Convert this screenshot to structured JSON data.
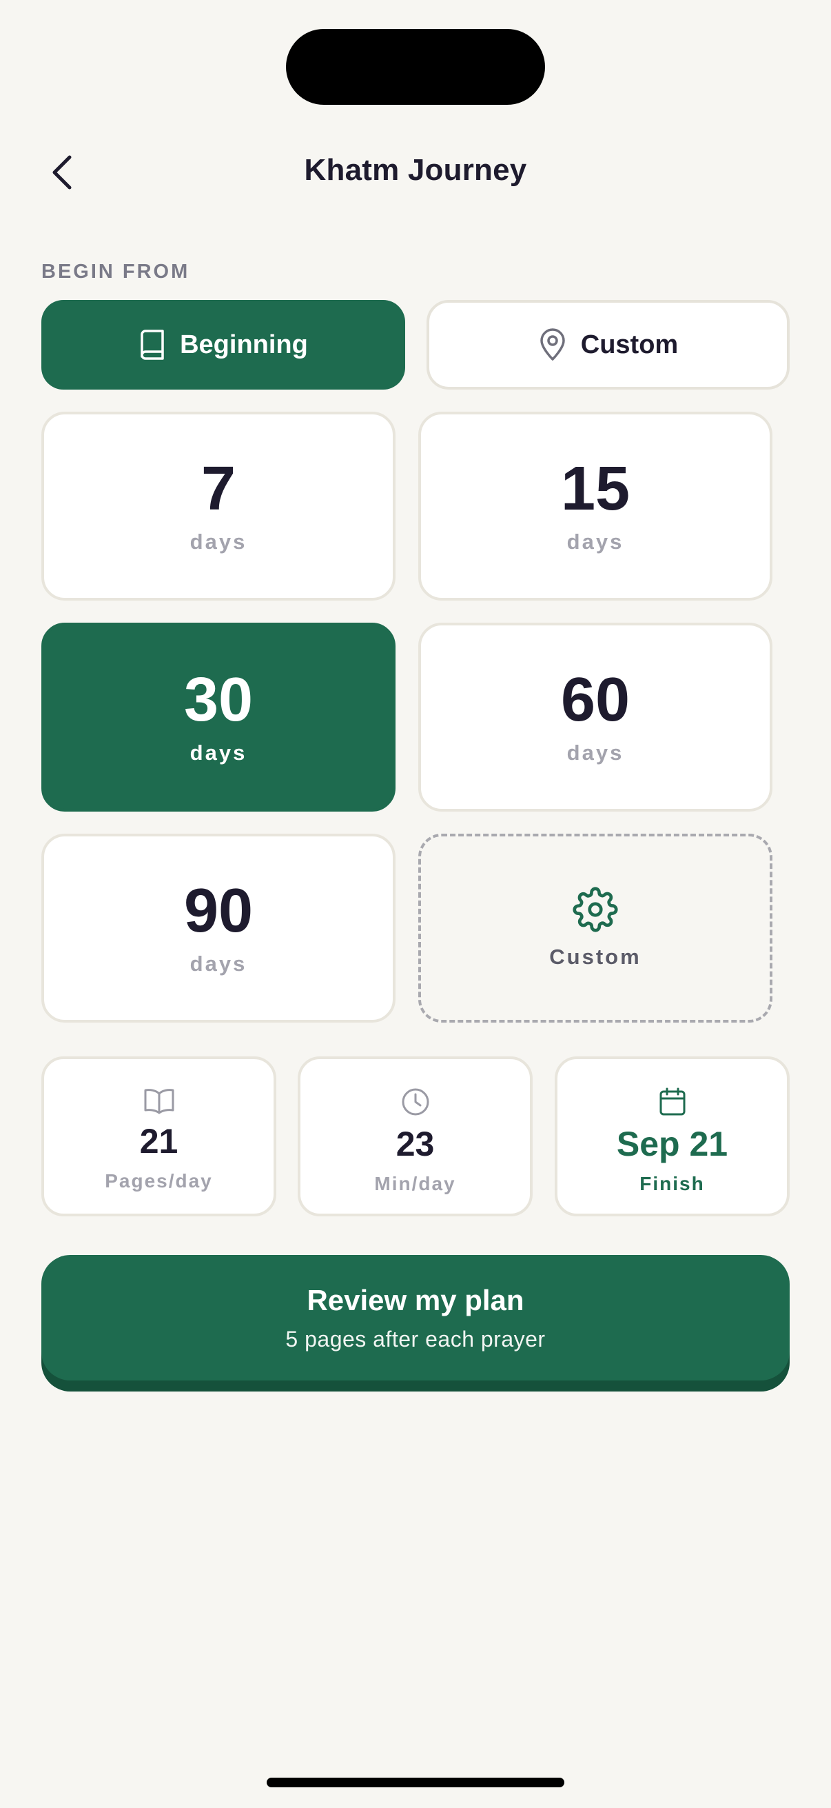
{
  "header": {
    "title": "Khatm Journey",
    "back_icon": "chevron-left-icon"
  },
  "begin_from": {
    "label": "BEGIN FROM",
    "options": [
      {
        "label": "Beginning",
        "icon": "book-icon",
        "selected": true
      },
      {
        "label": "Custom",
        "icon": "map-pin-icon",
        "selected": false
      }
    ]
  },
  "durations": [
    {
      "value": "7",
      "unit": "days",
      "selected": false
    },
    {
      "value": "15",
      "unit": "days",
      "selected": false
    },
    {
      "value": "30",
      "unit": "days",
      "selected": true
    },
    {
      "value": "60",
      "unit": "days",
      "selected": false
    },
    {
      "value": "90",
      "unit": "days",
      "selected": false
    }
  ],
  "custom_duration": {
    "label": "Custom",
    "icon": "gear-icon"
  },
  "stats": [
    {
      "value": "21",
      "label": "Pages/day",
      "icon": "open-book-icon"
    },
    {
      "value": "23",
      "label": "Min/day",
      "icon": "clock-icon"
    },
    {
      "value": "Sep 21",
      "label": "Finish",
      "icon": "calendar-icon"
    }
  ],
  "cta": {
    "title": "Review my plan",
    "subtitle": "5 pages after each prayer"
  },
  "colors": {
    "accent": "#1E6B4F",
    "background": "#F7F6F2",
    "text": "#1E1B2E",
    "muted": "#A3A3AD"
  }
}
